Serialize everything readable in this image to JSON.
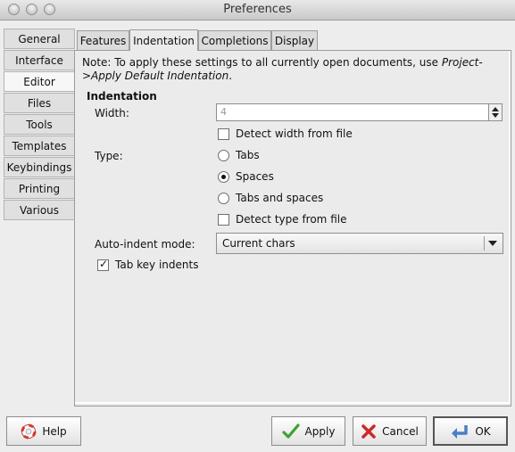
{
  "window": {
    "title": "Preferences"
  },
  "sidebar": {
    "items": [
      {
        "label": "General"
      },
      {
        "label": "Interface"
      },
      {
        "label": "Editor"
      },
      {
        "label": "Files"
      },
      {
        "label": "Tools"
      },
      {
        "label": "Templates"
      },
      {
        "label": "Keybindings"
      },
      {
        "label": "Printing"
      },
      {
        "label": "Various"
      }
    ],
    "selected": "Editor"
  },
  "tabs": {
    "items": [
      {
        "label": "Features"
      },
      {
        "label": "Indentation"
      },
      {
        "label": "Completions"
      },
      {
        "label": "Display"
      }
    ],
    "selected": "Indentation"
  },
  "indentation": {
    "note_prefix": "Note: To apply these settings to all currently open documents, use ",
    "note_emphasis": "Project->Apply Default Indentation",
    "note_suffix": ".",
    "section_title": "Indentation",
    "width_label": "Width:",
    "width_value": "4",
    "detect_width_label": "Detect width from file",
    "detect_width_checked": false,
    "type_label": "Type:",
    "type_options": [
      {
        "label": "Tabs",
        "selected": false
      },
      {
        "label": "Spaces",
        "selected": true
      },
      {
        "label": "Tabs and spaces",
        "selected": false
      }
    ],
    "detect_type_label": "Detect type from file",
    "detect_type_checked": false,
    "auto_indent_label": "Auto-indent mode:",
    "auto_indent_value": "Current chars",
    "tab_key_indents_label": "Tab key indents",
    "tab_key_indents_checked": true
  },
  "buttons": {
    "help": "Help",
    "apply": "Apply",
    "cancel": "Cancel",
    "ok": "OK"
  },
  "icons": {
    "help": "lifebuoy-icon",
    "apply": "checkmark-icon",
    "cancel": "x-mark-icon",
    "ok": "enter-arrow-icon"
  },
  "colors": {
    "apply_icon": "#3aa52f",
    "cancel_icon": "#c92a2a",
    "help_icon": "#d7352b",
    "ok_icon": "#4b7fc4"
  }
}
